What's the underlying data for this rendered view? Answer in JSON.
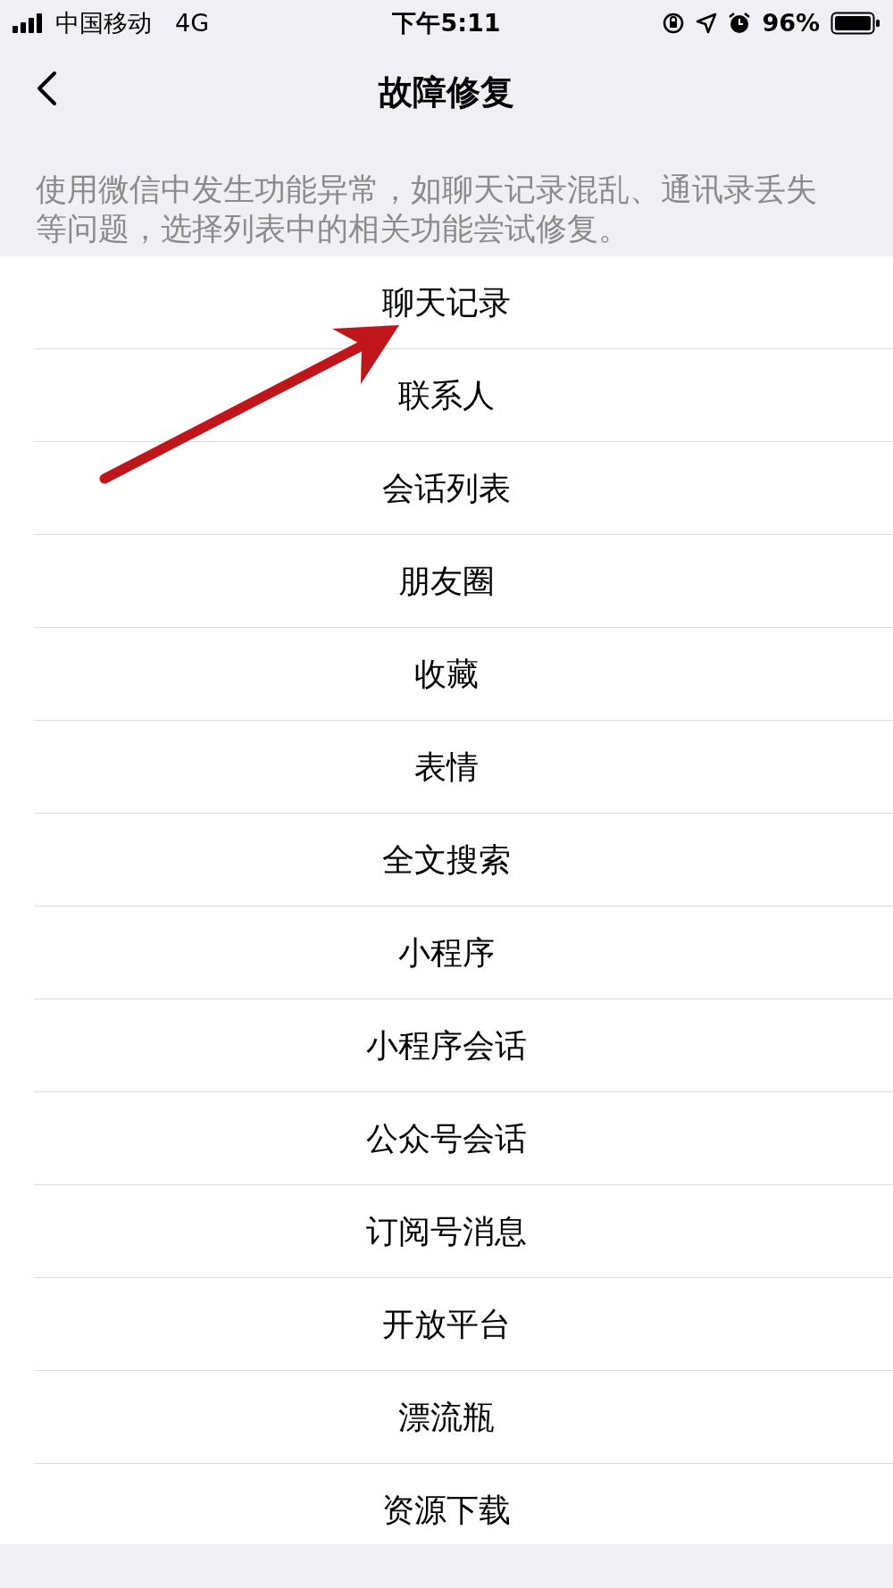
{
  "status_bar": {
    "carrier": "中国移动",
    "network": "4G",
    "time": "下午5:11",
    "battery": "96%"
  },
  "nav": {
    "title": "故障修复"
  },
  "description": "使用微信中发生功能异常，如聊天记录混乱、通讯录丢失等问题，选择列表中的相关功能尝试修复。",
  "items": [
    {
      "label": "聊天记录"
    },
    {
      "label": "联系人"
    },
    {
      "label": "会话列表"
    },
    {
      "label": "朋友圈"
    },
    {
      "label": "收藏"
    },
    {
      "label": "表情"
    },
    {
      "label": "全文搜索"
    },
    {
      "label": "小程序"
    },
    {
      "label": "小程序会话"
    },
    {
      "label": "公众号会话"
    },
    {
      "label": "订阅号消息"
    },
    {
      "label": "开放平台"
    },
    {
      "label": "漂流瓶"
    },
    {
      "label": "资源下载"
    }
  ]
}
